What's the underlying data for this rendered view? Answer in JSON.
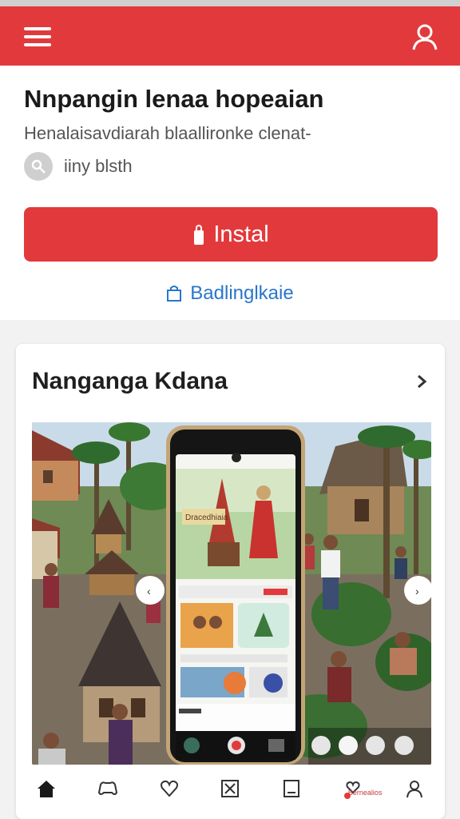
{
  "header": {
    "menu_icon": "hamburger-menu-icon",
    "account_icon": "user-icon",
    "accent_color": "#e23a3c"
  },
  "hero": {
    "title": "Nnpangin lenaa hopeaian",
    "description_line1": "Henalaisavdiarah blaallironke clenat-",
    "description_line2": "iiny blsth",
    "install_label": "Instal",
    "secondary_link_label": "Badlinglkaie"
  },
  "card": {
    "title": "Nanganga Kdana",
    "phone": {
      "banner_text": "Dracedhiaia"
    }
  },
  "bottom_nav": {
    "badge_label": "Bernealios",
    "icon_color": "#333333"
  }
}
